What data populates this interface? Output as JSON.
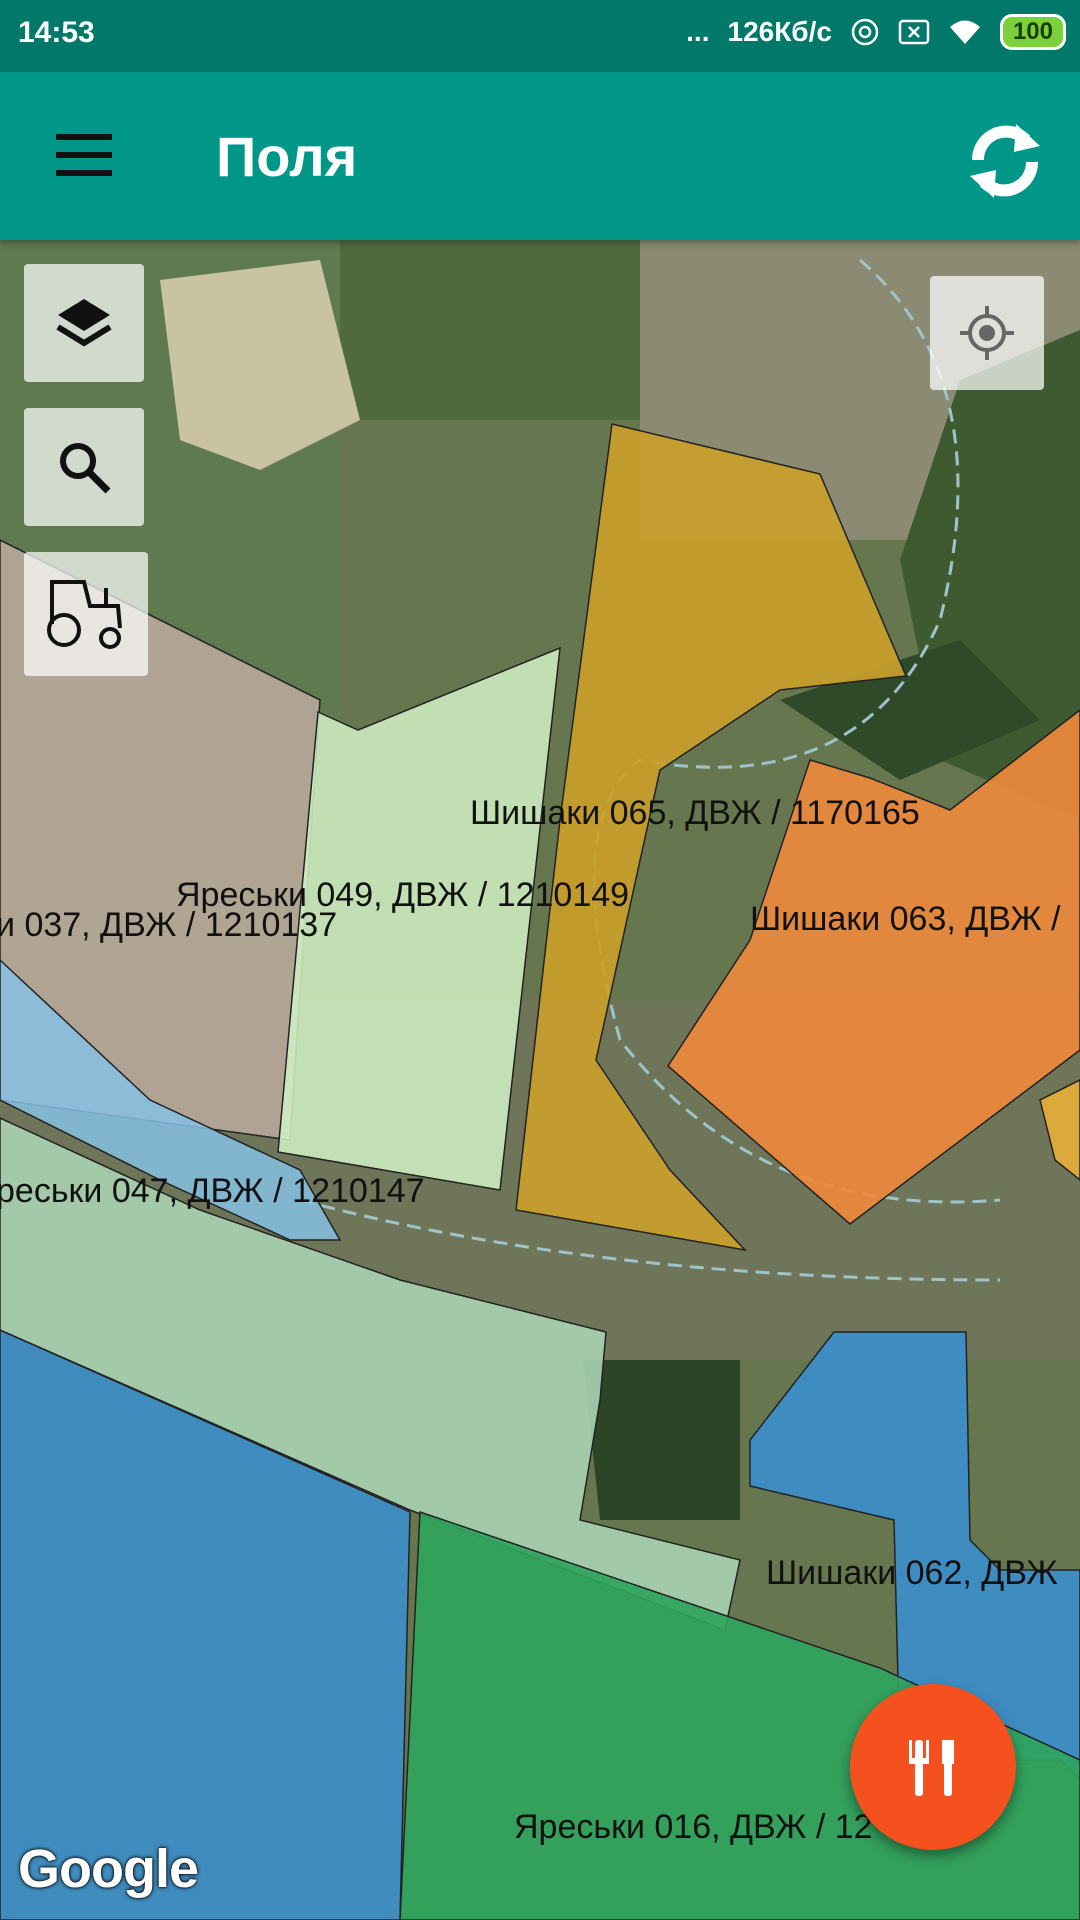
{
  "status_bar": {
    "time": "14:53",
    "dots": "...",
    "network_speed": "126Кб/с",
    "battery": "100"
  },
  "app_bar": {
    "title": "Поля",
    "menu_icon": "hamburger-menu-icon",
    "sync_icon": "sync-icon"
  },
  "map": {
    "controls": {
      "layers_icon": "layers-icon",
      "search_icon": "search-icon",
      "tractor_icon": "tractor-icon",
      "location_icon": "my-location-icon"
    },
    "fields": [
      {
        "label": "Шишаки 065, ДВЖ / 1170165",
        "color": "#c9a02a"
      },
      {
        "label": "Яреськи 049, ДВЖ / 1210149",
        "color": "#cfeec2"
      },
      {
        "label": "и 037, ДВЖ / 1210137",
        "color": "#b8a99a"
      },
      {
        "label": "Шишаки 063, ДВЖ /",
        "color": "#f08a3c"
      },
      {
        "label": "реськи 047, ДВЖ / 1210147",
        "color": "#a9d3b3"
      },
      {
        "label": "Шишаки 062, ДВЖ",
        "color": "#3a8fd1"
      },
      {
        "label": "Яреськи 016, ДВЖ / 12",
        "color": "#2fa45d"
      }
    ],
    "watermark": "Google"
  },
  "fab": {
    "icon": "tools-icon"
  }
}
